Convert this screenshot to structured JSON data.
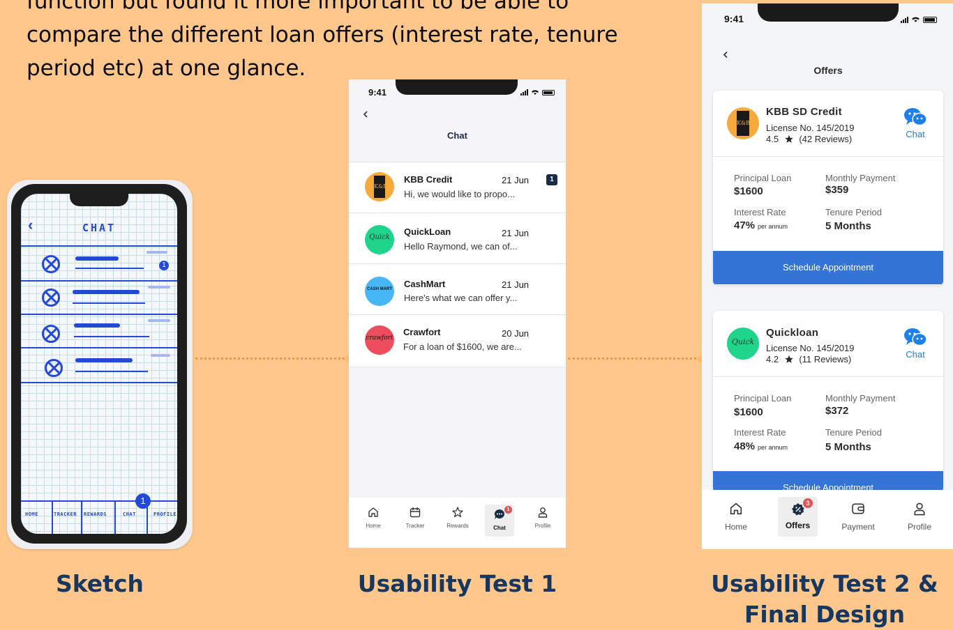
{
  "intro": {
    "text": "function but found it more important to be able to compare the different loan offers (interest rate, tenure period etc) at one glance."
  },
  "captions": {
    "sketch": "Sketch",
    "test1": "Usability Test 1",
    "test2": "Usability Test 2 & Final Design"
  },
  "sketch": {
    "title": "CHAT",
    "badge": "1",
    "tab_badge": "1",
    "tabs": [
      "HOME",
      "TRACKER",
      "REWARDS",
      "CHAT",
      "PROFILE"
    ]
  },
  "chat_screen": {
    "time": "9:41",
    "title": "Chat",
    "items": [
      {
        "name": "KBB Credit",
        "date": "21 Jun",
        "message": "Hi, we would like to propo...",
        "unread": "1",
        "avatar_color": "#F7A93B"
      },
      {
        "name": "QuickLoan",
        "date": "21 Jun",
        "message": "Hello Raymond, we can of...",
        "avatar_color": "#1FD58C"
      },
      {
        "name": "CashMart",
        "date": "21 Jun",
        "message": "Here's what we can offer y...",
        "avatar_color": "#47B6F5"
      },
      {
        "name": "Crawfort",
        "date": "20 Jun",
        "message": "For a loan of $1600, we are...",
        "avatar_color": "#EE4D5F"
      }
    ],
    "tabs": [
      "Home",
      "Tracker",
      "Rewards",
      "Chat",
      "Profile"
    ],
    "active_tab": "Chat",
    "chat_badge": "1",
    "logos": {
      "kbb": "K&B",
      "quick": "Quick",
      "cash": "CASH MART",
      "craw": "crawfort"
    }
  },
  "offers_screen": {
    "time": "9:41",
    "title": "Offers",
    "cards": [
      {
        "name": "KBB SD Credit",
        "license": "License No. 145/2019",
        "rating": "4.5",
        "reviews": "(42 Reviews)",
        "chat_label": "Chat",
        "principal_label": "Principal Loan",
        "principal": "$1600",
        "monthly_label": "Monthly Payment",
        "monthly": "$359",
        "interest_label": "Interest Rate",
        "interest": "47%",
        "interest_unit": "per annum",
        "tenure_label": "Tenure Period",
        "tenure": "5 Months",
        "button": "Schedule Appointment"
      },
      {
        "name": "Quickloan",
        "license": "License No. 145/2019",
        "rating": "4.2",
        "reviews": "(11 Reviews)",
        "chat_label": "Chat",
        "principal_label": "Principal Loan",
        "principal": "$1600",
        "monthly_label": "Monthly Payment",
        "monthly": "$372",
        "interest_label": "Interest Rate",
        "interest": "48%",
        "interest_unit": "per annum",
        "tenure_label": "Tenure Period",
        "tenure": "5 Months",
        "button": "Schedule Appointment"
      }
    ],
    "tabs": [
      "Home",
      "Offers",
      "Payment",
      "Profile"
    ],
    "active_tab": "Offers",
    "offers_badge": "3",
    "logos": {
      "kbb": "K&B",
      "quick": "Quick"
    }
  },
  "colors": {
    "background": "#FFC78B",
    "caption": "#16375F",
    "primary_button": "#3474D6",
    "chat_link": "#1E7FE8",
    "sketch_ink": "#2448D8",
    "connector": "#F3973C"
  }
}
